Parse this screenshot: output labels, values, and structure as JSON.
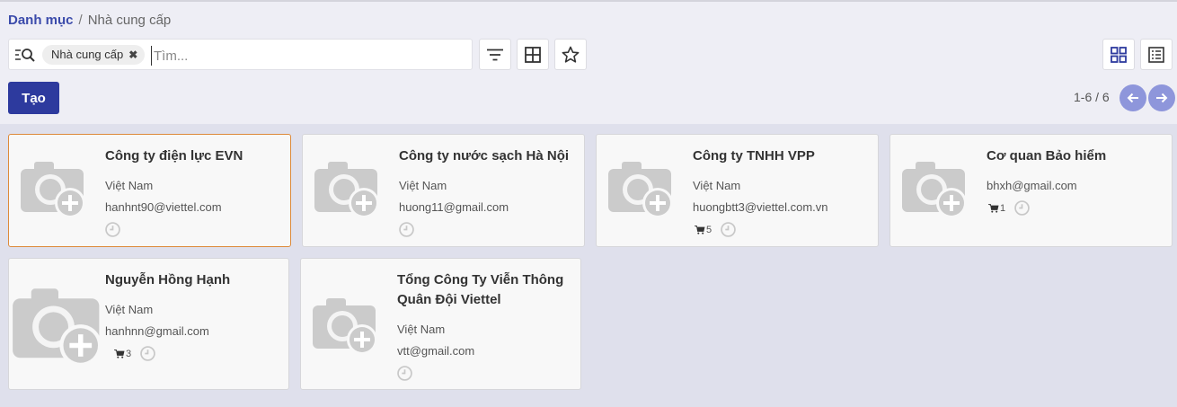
{
  "breadcrumb": {
    "parent": "Danh mục",
    "separator": "/",
    "current": "Nhà cung cấp"
  },
  "search": {
    "facet": "Nhà cung cấp",
    "placeholder": "Tìm..."
  },
  "toolbar": {
    "create_label": "Tạo",
    "pager": "1-6 / 6"
  },
  "colors": {
    "accent": "#2d3a9e",
    "nav_button": "#8e96db",
    "selected_border": "#dd8a3a"
  },
  "cards": [
    {
      "name": "Công ty điện lực EVN",
      "country": "Việt Nam",
      "email": "hanhnt90@viettel.com",
      "orders": ""
    },
    {
      "name": "Công ty nước sạch Hà Nội",
      "country": "Việt Nam",
      "email": "huong11@gmail.com",
      "orders": ""
    },
    {
      "name": "Công ty TNHH VPP",
      "country": "Việt Nam",
      "email": "huongbtt3@viettel.com.vn",
      "orders": "5"
    },
    {
      "name": "Cơ quan Bảo hiểm",
      "country": "",
      "email": "bhxh@gmail.com",
      "orders": "1"
    },
    {
      "name": "Nguyễn Hồng Hạnh",
      "country": "Việt Nam",
      "email": "hanhnn@gmail.com",
      "orders": "3"
    },
    {
      "name": "Tổng Công Ty Viễn Thông Quân Đội Viettel",
      "country": "Việt Nam",
      "email": "vtt@gmail.com",
      "orders": ""
    }
  ],
  "icons": [
    "search-icon",
    "filter-icon",
    "group-by-icon",
    "favorite-star-icon",
    "kanban-view-icon",
    "list-view-icon",
    "arrow-left-icon",
    "arrow-right-icon",
    "camera-add-placeholder-icon",
    "cart-icon",
    "clock-icon"
  ]
}
